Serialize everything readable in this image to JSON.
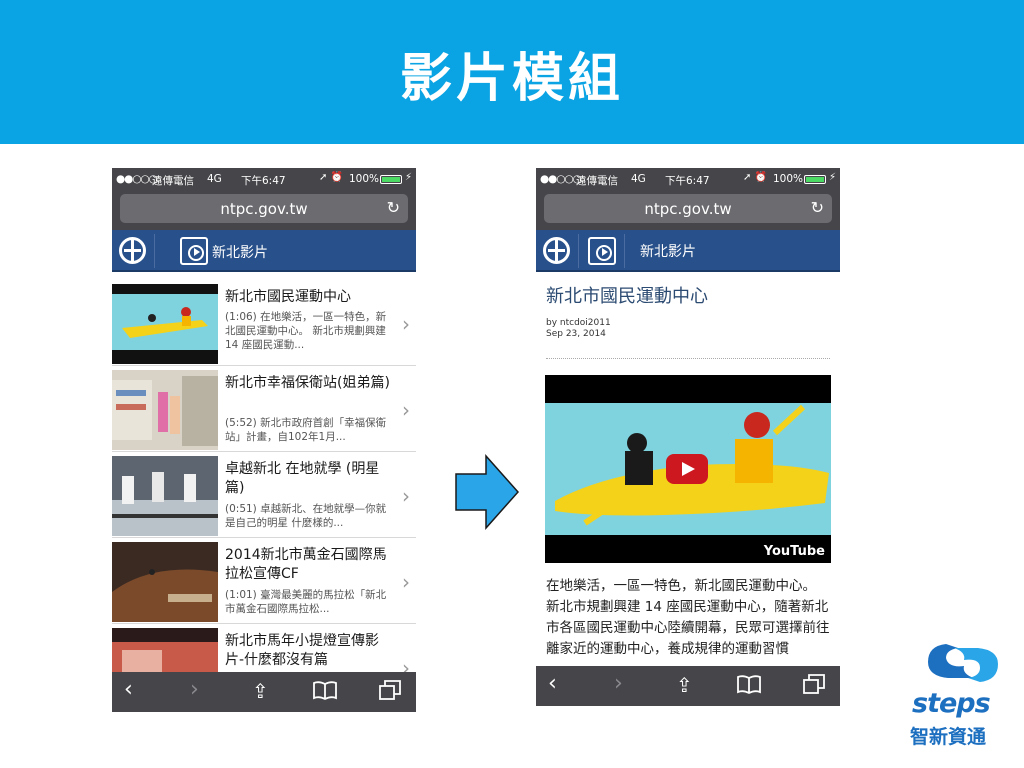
{
  "slide": {
    "title": "影片模組"
  },
  "phone": {
    "status": {
      "signal": "●●○○○",
      "carrier": "遠傳電信",
      "network": "4G",
      "time": "下午6:47",
      "icons": "➚ ⏰",
      "battery": "100%"
    },
    "url": "ntpc.gov.tw",
    "site_title": "新北影片",
    "toolbar": {
      "back": "‹",
      "forward": "›",
      "share": "⇪",
      "bookmarks": "📖",
      "tabs": "⧉"
    }
  },
  "video_list": [
    {
      "title": "新北市國民運動中心",
      "desc": "(1:06) 在地樂活，一區一特色，新北國民運動中心。 新北市規劃興建 14 座國民運動..."
    },
    {
      "title": "新北市幸福保衛站(姐弟篇)",
      "desc": "(5:52) 新北市政府首創「幸福保衛站」計畫，自102年1月..."
    },
    {
      "title": "卓越新北 在地就學 (明星篇)",
      "desc": "(0:51) 卓越新北、在地就學—你就是自己的明星 什麼樣的..."
    },
    {
      "title": "2014新北市萬金石國際馬拉松宣傳CF",
      "desc": "(1:01) 臺灣最美麗的馬拉松「新北市萬金石國際馬拉松..."
    },
    {
      "title": "新北市馬年小提燈宣傳影片-什麼都沒有篇",
      "desc": ""
    }
  ],
  "detail": {
    "title": "新北市國民運動中心",
    "author": "by ntcdoi2011",
    "date": "Sep 23, 2014",
    "player_brand": "YouTube",
    "body": "在地樂活，一區一特色，新北國民運動中心。 新北市規劃興建 14 座國民運動中心，隨著新北市各區國民運動中心陸續開幕，民眾可選擇前往離家近的運動中心，養成規律的運動習慣"
  },
  "logo": {
    "brand": "steps",
    "sub": "智新資通"
  },
  "colors": {
    "banner": "#0aa3e3",
    "site_bar": "#28508a",
    "arrow": "#2aa5e8",
    "brand": "#1d6fc0"
  }
}
